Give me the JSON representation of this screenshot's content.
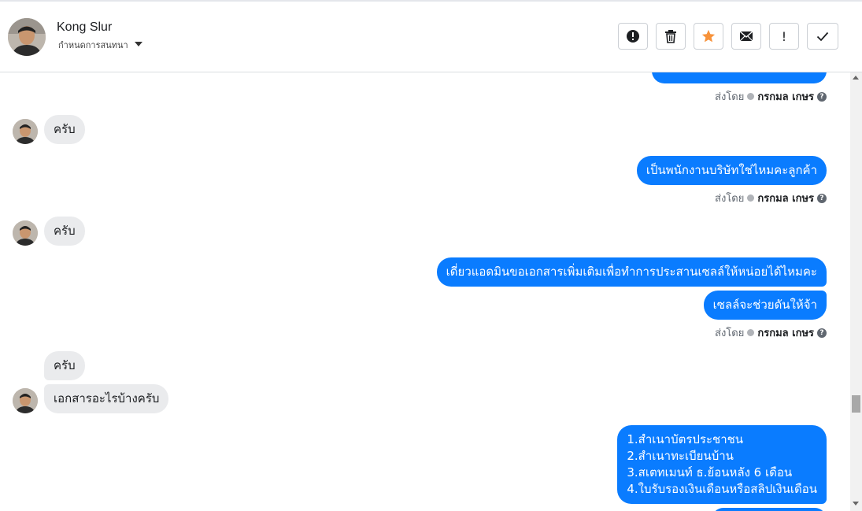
{
  "header": {
    "name": "Kong Slur",
    "subtitle": "กำหนดการสนทนา",
    "buttons": [
      {
        "icon": "alert-circle-icon",
        "label": ""
      },
      {
        "icon": "trash-icon",
        "label": ""
      },
      {
        "icon": "star-icon",
        "label": "",
        "color": "#f7923a"
      },
      {
        "icon": "envelope-icon",
        "label": ""
      },
      {
        "icon": "exclamation-icon",
        "label": "!"
      },
      {
        "icon": "check-icon",
        "label": ""
      }
    ]
  },
  "messages": {
    "sent_by_label": "ส่งโดย",
    "sender_name": "กรกมล เกษร",
    "m1": "ครับ",
    "m2": "เป็นพนักงานบริษัทใช่ไหมคะลูกค้า",
    "m3": "ครับ",
    "m4": "เดี่ยวแอดมินขอเอกสารเพิ่มเติมเพื่อทำการประสานเซลล์ให้หน่อยได้ไหมคะ",
    "m5": "เซลล์จะช่วยดันให้จ้า",
    "m6": "ครับ",
    "m7": "เอกสารอะไรบ้างครับ",
    "m8": [
      "1.สำเนาบัตรประชาชน",
      "2.สำเนาทะเบียนบ้าน",
      "3.สเตทเมนท์ ธ.ย้อนหลัง 6 เดือน",
      "4.ใบรับรองเงินเดือนหรือสลิปเงินเดือน"
    ]
  },
  "colors": {
    "outgoing_bubble": "#0a7cff",
    "incoming_bubble": "#eaebed",
    "star": "#f7923a"
  }
}
